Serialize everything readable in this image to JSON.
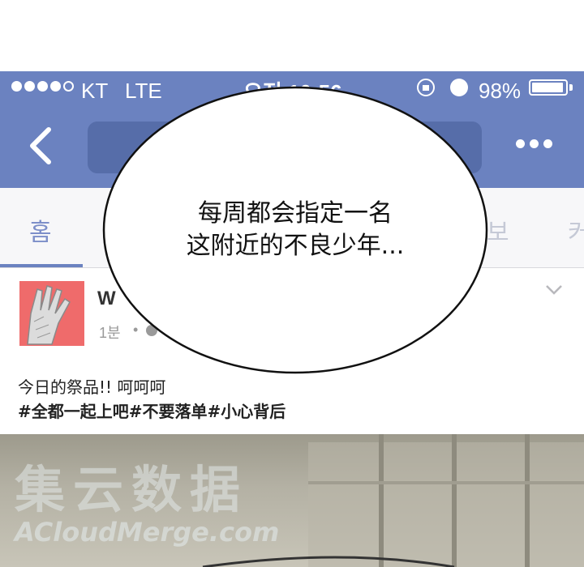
{
  "status_bar": {
    "carrier": "KT",
    "network": "LTE",
    "time": "오전 10:56",
    "battery": "98%",
    "battery_level": 0.98,
    "icons": [
      "signal-dots-icon",
      "rotation-lock-icon",
      "alarm-icon",
      "battery-icon"
    ]
  },
  "nav_bar": {
    "icons": [
      "back-chevron-icon",
      "more-dots-icon"
    ],
    "accent_color": "#6b82c0"
  },
  "tabs": [
    {
      "label": "홈",
      "active": true
    },
    {
      "label": "보",
      "active": false
    },
    {
      "label": "커",
      "active": false
    }
  ],
  "post": {
    "author": "W",
    "time": "1분",
    "separator": "•",
    "text": "今日的祭品!! 呵呵呵",
    "tags": "#全都一起上吧#不要落单#小心背后"
  },
  "bubble": {
    "line1": "每周都会指定一名",
    "line2": "这附近的不良少年..."
  },
  "watermark": {
    "cn": "集云数据",
    "en": "ACloudMerge.com"
  }
}
